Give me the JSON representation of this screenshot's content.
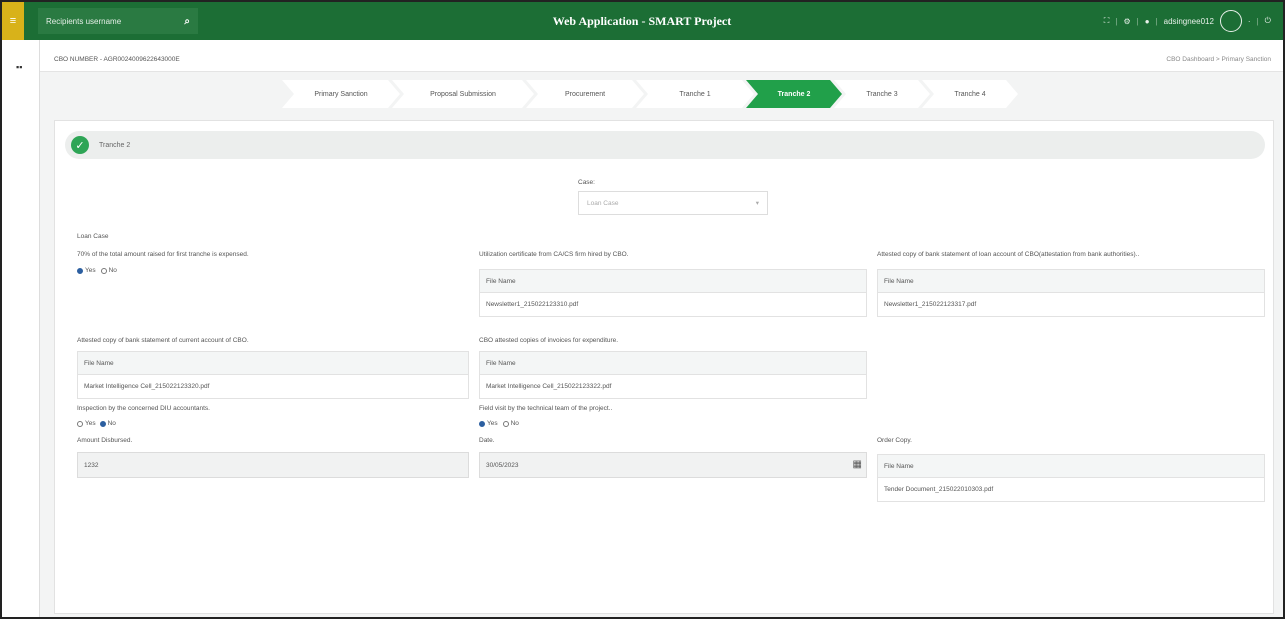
{
  "header": {
    "menu_icon": "hamburger-icon",
    "search_placeholder": "Recipients username",
    "title": "Web Application - SMART Project",
    "username": "adsingnee012",
    "accent_color": "#1c6e35"
  },
  "crumbbar": {
    "cbo_number": "CBO NUMBER - AGR0024009622643000E",
    "breadcrumb": "CBO Dashboard  >  Primary Sanction"
  },
  "stepper": [
    {
      "label": "Primary Sanction",
      "active": false
    },
    {
      "label": "Proposal Submission",
      "active": false
    },
    {
      "label": "Procurement",
      "active": false
    },
    {
      "label": "Tranche 1",
      "active": false
    },
    {
      "label": "Tranche 2",
      "active": true
    },
    {
      "label": "Tranche 3",
      "active": false
    },
    {
      "label": "Tranche 4",
      "active": false
    }
  ],
  "section": {
    "title": "Tranche 2",
    "case_label": "Case:",
    "case_value": "Loan Case",
    "loan_case_heading": "Loan Case",
    "q_expensed": "70% of the total amount raised for first tranche is expensed.",
    "q_expensed_yes": "Yes",
    "q_expensed_no": "No",
    "utilization_label": "Utilization certificate from CA/CS firm hired by CBO.",
    "utilization_file_header": "File Name",
    "utilization_file": "Newsletter1_215022123310.pdf",
    "attested_loan_label": "Attested copy of bank statement of loan account of CBO(attestation from bank authorities)..",
    "attested_loan_file_header": "File Name",
    "attested_loan_file": "Newsletter1_215022123317.pdf",
    "attested_current_label": "Attested copy of bank statement of current account of CBO.",
    "attested_current_file_header": "File Name",
    "attested_current_file": "Market Intelligence Cell_215022123320.pdf",
    "invoices_label": "CBO attested copies of invoices for expenditure.",
    "invoices_file_header": "File Name",
    "invoices_file": "Market Intelligence Cell_215022123322.pdf",
    "inspection_label": "Inspection by the concerned DIU accountants.",
    "inspection_yes": "Yes",
    "inspection_no": "No",
    "field_visit_label": "Field visit by the technical team of the project..",
    "field_visit_yes": "Yes",
    "field_visit_no": "No",
    "amount_label": "Amount Disbursed.",
    "amount_value": "1232",
    "date_label": "Date.",
    "date_value": "30/05/2023",
    "order_copy_label": "Order Copy.",
    "order_copy_file_header": "File Name",
    "order_copy_file": "Tender Document_215022010303.pdf"
  }
}
